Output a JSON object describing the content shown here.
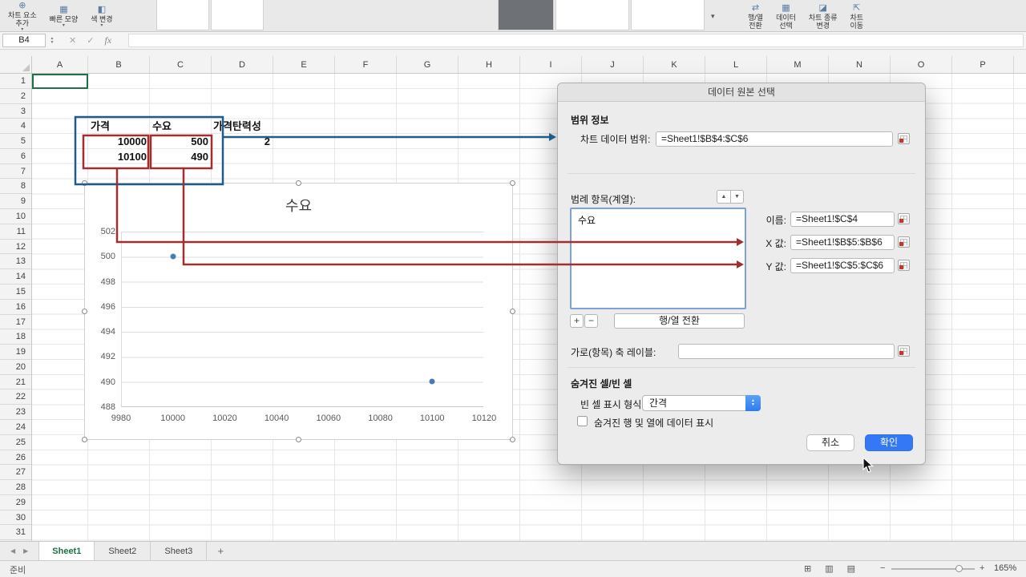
{
  "icons": {
    "up": "▲",
    "down": "▼",
    "left": "◀",
    "right": "▶",
    "plus": "+",
    "minus": "−"
  },
  "ribbon": {
    "left_buttons": [
      {
        "label": "차트 요소\n추가",
        "glyph": "⊕",
        "caret": "▾"
      },
      {
        "label": "빠른 모양",
        "glyph": "▦",
        "caret": "▾"
      },
      {
        "label": "색 변경",
        "glyph": "◧",
        "caret": "▾"
      }
    ],
    "right_buttons": [
      {
        "label": "행/열\n전환",
        "glyph": "⇄",
        "caret": ""
      },
      {
        "label": "데이터\n선택",
        "glyph": "▦",
        "caret": ""
      },
      {
        "label": "차트 종류\n변경",
        "glyph": "◪",
        "caret": ""
      },
      {
        "label": "차트\n이동",
        "glyph": "⇱",
        "caret": ""
      }
    ]
  },
  "formula_bar": {
    "name_box": "B4",
    "cancel": "✕",
    "enter": "✓",
    "fx": "fx"
  },
  "grid": {
    "columns": [
      "A",
      "B",
      "C",
      "D",
      "E",
      "F",
      "G",
      "H",
      "I",
      "J",
      "K",
      "L",
      "M",
      "N",
      "O",
      "P"
    ],
    "rows": [
      "1",
      "2",
      "3",
      "4",
      "5",
      "6",
      "7",
      "8",
      "9",
      "10",
      "11",
      "12",
      "13",
      "14",
      "15",
      "16",
      "17",
      "18",
      "19",
      "20",
      "21",
      "22",
      "23",
      "24",
      "25",
      "26",
      "27",
      "28",
      "29",
      "30",
      "31"
    ],
    "cells": {
      "b4": "가격",
      "c4": "수요",
      "d4": "가격탄력성",
      "b5": "10000",
      "c5": "500",
      "d5": "2",
      "b6": "10100",
      "c6": "490"
    }
  },
  "chart_data": {
    "type": "scatter",
    "title": "수요",
    "series": [
      {
        "name": "수요",
        "points": [
          [
            10000,
            500
          ],
          [
            10100,
            490
          ]
        ]
      }
    ],
    "x_ticks": [
      "9980",
      "10000",
      "10020",
      "10040",
      "10060",
      "10080",
      "10100",
      "10120"
    ],
    "y_ticks": [
      "502",
      "500",
      "498",
      "496",
      "494",
      "492",
      "490",
      "488"
    ],
    "xlim": [
      9980,
      10120
    ],
    "ylim": [
      488,
      502
    ],
    "xlabel": "",
    "ylabel": "",
    "grid": "horizontal",
    "point_color": "#4a7ab8"
  },
  "dialog": {
    "title": "데이터 원본 선택",
    "section_range": "범위 정보",
    "chart_range_label": "차트 데이터 범위:",
    "chart_range_value": "=Sheet1!$B$4:$C$6",
    "legend_label": "범례 항목(계열):",
    "legend_items": [
      "수요"
    ],
    "name_label": "이름:",
    "name_value": "=Sheet1!$C$4",
    "x_label": "X 값:",
    "x_value": "=Sheet1!$B$5:$B$6",
    "y_label": "Y 값:",
    "y_value": "=Sheet1!$C$5:$C$6",
    "switch_button": "행/열 전환",
    "axis_labels_label": "가로(항목) 축 레이블:",
    "hidden_section": "숨겨진 셀/빈 셀",
    "empty_cell_label": "빈 셀 표시 형식:",
    "empty_cell_value": "간격",
    "hidden_checkbox_label": "숨겨진 행 및 열에 데이터 표시",
    "cancel_button": "취소",
    "ok_button": "확인"
  },
  "annotation_colors": {
    "blue": "#1f5c8a",
    "red": "#a22f2f"
  },
  "sheet_tabs": {
    "tabs": [
      "Sheet1",
      "Sheet2",
      "Sheet3"
    ],
    "active": "Sheet1",
    "add_label": "+"
  },
  "status_bar": {
    "ready": "준비",
    "view_icons": [
      "⊞",
      "▥",
      "▤"
    ],
    "zoom_minus": "−",
    "zoom_plus": "+",
    "zoom": "165%"
  }
}
